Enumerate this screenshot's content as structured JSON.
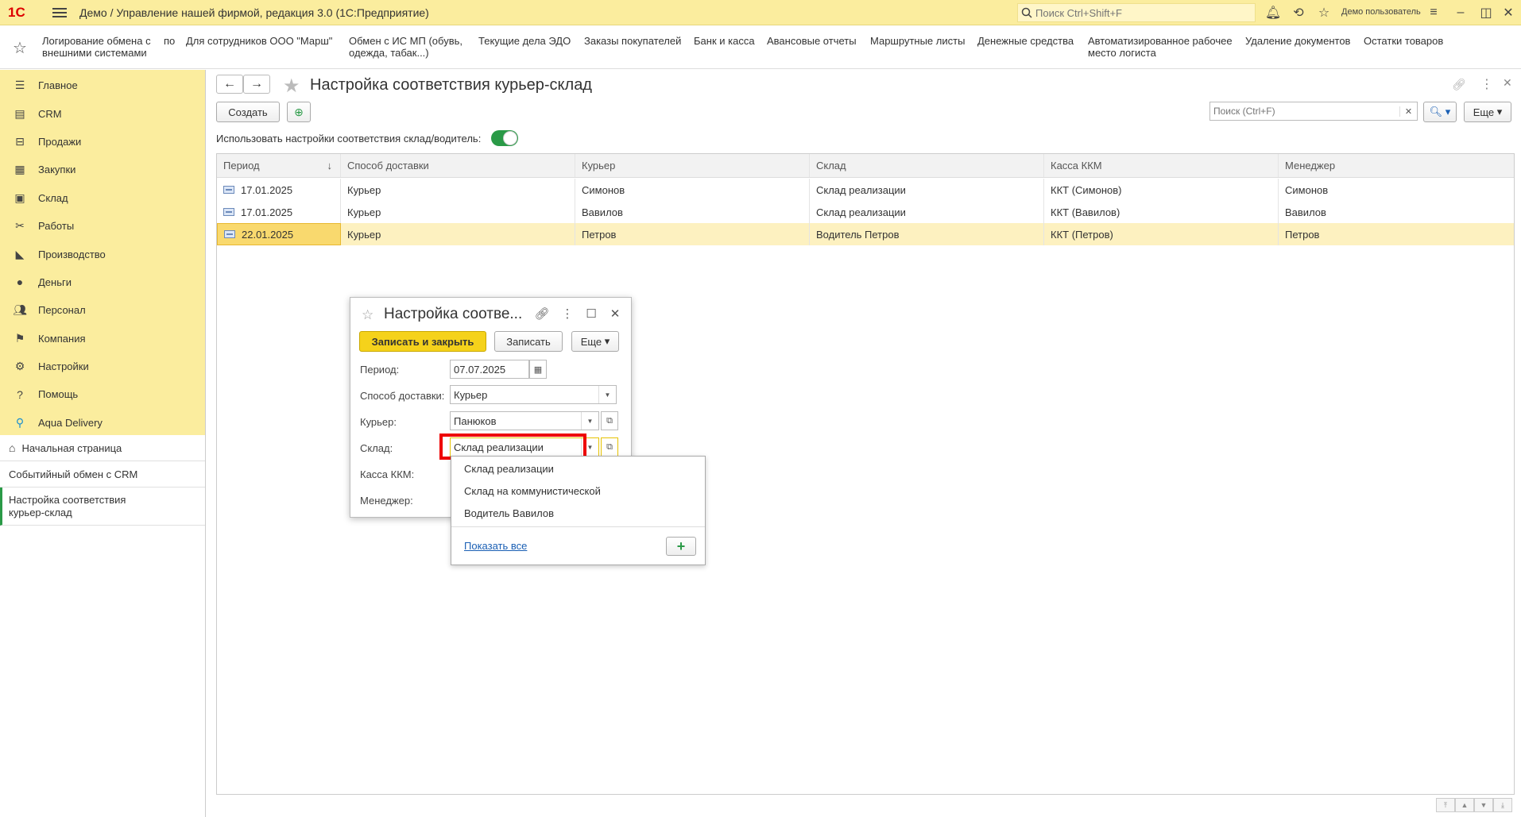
{
  "titlebar": {
    "logo": "1С",
    "title": "Демо / Управление нашей фирмой, редакция 3.0  (1С:Предприятие)",
    "search_placeholder": "Поиск Ctrl+Shift+F",
    "user": "Демо пользователь"
  },
  "favorites": [
    "Логирование обмена с внешними системами",
    "по",
    "Для сотрудников ООО \"Марш\"",
    "Обмен с ИС МП (обувь, одежда, табак...)",
    "Текущие дела ЭДО",
    "Заказы покупателей",
    "Банк и касса",
    "Авансовые отчеты",
    "Маршрутные листы",
    "Денежные средства",
    "Автоматизированное рабочее место логиста",
    "Удаление документов",
    "Остатки товаров"
  ],
  "sidebar": {
    "sections": [
      {
        "label": "Главное",
        "icon": "list-icon"
      },
      {
        "label": "CRM",
        "icon": "crm-icon"
      },
      {
        "label": "Продажи",
        "icon": "basket-icon"
      },
      {
        "label": "Закупки",
        "icon": "cart-icon"
      },
      {
        "label": "Склад",
        "icon": "warehouse-icon"
      },
      {
        "label": "Работы",
        "icon": "tools-icon"
      },
      {
        "label": "Производство",
        "icon": "factory-icon"
      },
      {
        "label": "Деньги",
        "icon": "coin-icon"
      },
      {
        "label": "Персонал",
        "icon": "people-icon"
      },
      {
        "label": "Компания",
        "icon": "flag-icon"
      },
      {
        "label": "Настройки",
        "icon": "gear-icon"
      },
      {
        "label": "Помощь",
        "icon": "help-icon"
      },
      {
        "label": "Aqua Delivery",
        "icon": "location-icon"
      }
    ],
    "open_pages": [
      "Начальная страница",
      "Событийный обмен с CRM",
      "Настройка соответствия курьер-склад"
    ]
  },
  "page": {
    "title": "Настройка соответствия курьер-склад",
    "create_label": "Создать",
    "search_placeholder": "Поиск (Ctrl+F)",
    "more_label": "Еще",
    "toggle_label": "Использовать настройки соответствия склад/водитель:"
  },
  "table": {
    "columns": [
      "Период",
      "Способ доставки",
      "Курьер",
      "Склад",
      "Касса ККМ",
      "Менеджер"
    ],
    "sort_indicator": "↓",
    "rows": [
      [
        "17.01.2025",
        "Курьер",
        "Симонов",
        "Склад реализации",
        "ККТ (Симонов)",
        "Симонов"
      ],
      [
        "17.01.2025",
        "Курьер",
        "Вавилов",
        "Склад реализации",
        "ККТ (Вавилов)",
        "Вавилов"
      ],
      [
        "22.01.2025",
        "Курьер",
        "Петров",
        "Водитель Петров",
        "ККТ (Петров)",
        "Петров"
      ]
    ],
    "selected_row": 2
  },
  "dialog": {
    "title": "Настройка соотве...",
    "save_close_label": "Записать и закрыть",
    "save_label": "Записать",
    "more_label": "Еще",
    "fields": {
      "period_label": "Период:",
      "period_value": "07.07.2025",
      "delivery_label": "Способ доставки:",
      "delivery_value": "Курьер",
      "courier_label": "Курьер:",
      "courier_value": "Панюков",
      "warehouse_label": "Склад:",
      "warehouse_value": "Склад реализации",
      "kkm_label": "Касса ККМ:",
      "manager_label": "Менеджер:"
    }
  },
  "dropdown": {
    "items": [
      "Склад реализации",
      "Склад на коммунистической",
      "Водитель Вавилов"
    ],
    "show_all_label": "Показать все"
  },
  "colors": {
    "accent_yellow": "#fbed9e",
    "primary_button": "#f5d21b",
    "toggle_on": "#2a9a47",
    "highlight_red": "#e00000",
    "link_blue": "#1a5fb4"
  }
}
